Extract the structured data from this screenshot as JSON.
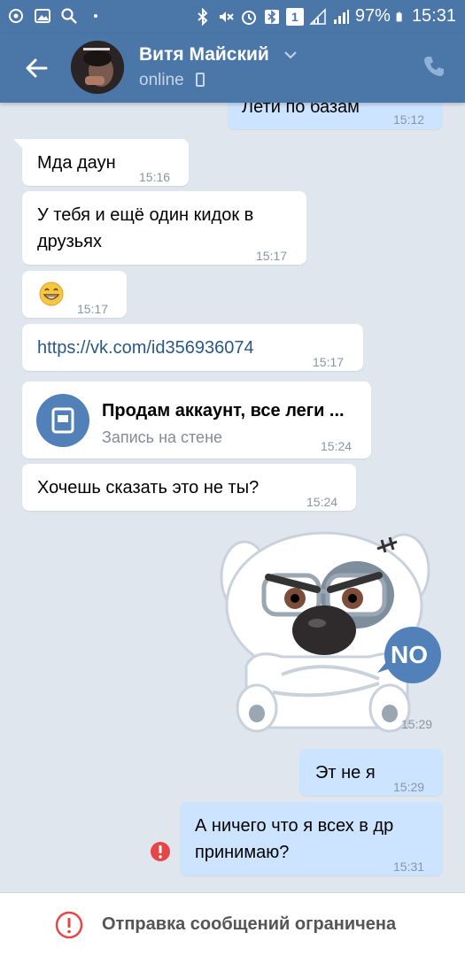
{
  "status_bar": {
    "battery": "97%",
    "time": "15:31",
    "sim": "1"
  },
  "header": {
    "contact_name": "Витя Майский",
    "status": "online"
  },
  "messages": [
    {
      "id": "m0",
      "direction": "out",
      "text": "Лети по базам",
      "time": "15:12"
    },
    {
      "id": "m1",
      "direction": "in",
      "text": "Мда даун",
      "time": "15:16"
    },
    {
      "id": "m2",
      "direction": "in",
      "lines": [
        "У тебя и ещё один кидок в",
        "друзьях"
      ],
      "time": "15:17"
    },
    {
      "id": "m3",
      "direction": "in",
      "text": "😄",
      "time": "15:17"
    },
    {
      "id": "m4",
      "direction": "in",
      "text": "https://vk.com/id356936074",
      "time": "15:17"
    },
    {
      "id": "m5",
      "direction": "in",
      "type": "wall_post",
      "title": "Продам аккаунт, все леги ...",
      "subtitle": "Запись на стене",
      "time": "15:24"
    },
    {
      "id": "m6",
      "direction": "in",
      "text": "Хочешь сказать это не ты?",
      "time": "15:24"
    },
    {
      "id": "m7",
      "direction": "out",
      "type": "sticker",
      "sticker_text": "NO",
      "time": "15:29"
    },
    {
      "id": "m8",
      "direction": "out",
      "text": "Эт не я",
      "time": "15:29"
    },
    {
      "id": "m9",
      "direction": "out",
      "lines": [
        "А ничего что я всех в др",
        "принимаю?"
      ],
      "time": "15:31",
      "failed": true
    }
  ],
  "footer": {
    "notice": "Отправка сообщений ограничена"
  },
  "colors": {
    "header": "#4a76a8",
    "background": "#dfe6ee",
    "incoming": "#ffffff",
    "outgoing": "#cce4ff",
    "error": "#e64646",
    "link": "#2a5885"
  }
}
